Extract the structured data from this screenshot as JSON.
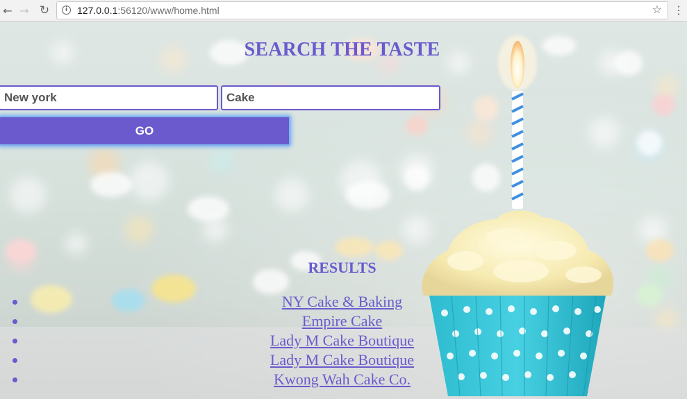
{
  "browser": {
    "url_host": "127.0.0.1",
    "url_rest": ":56120/www/home.html"
  },
  "page": {
    "title": "SEARCH THE TASTE",
    "location_input": {
      "value": "New york"
    },
    "term_input": {
      "value": "Cake"
    },
    "go_button_label": "GO",
    "results_heading": "RESULTS",
    "results": [
      "NY Cake & Baking",
      "Empire Cake",
      "Lady M Cake Boutique",
      "Lady M Cake Boutique",
      "Kwong Wah Cake Co."
    ]
  },
  "colors": {
    "accent": "#6a5acd",
    "button_glow": "#7fb2f0"
  }
}
